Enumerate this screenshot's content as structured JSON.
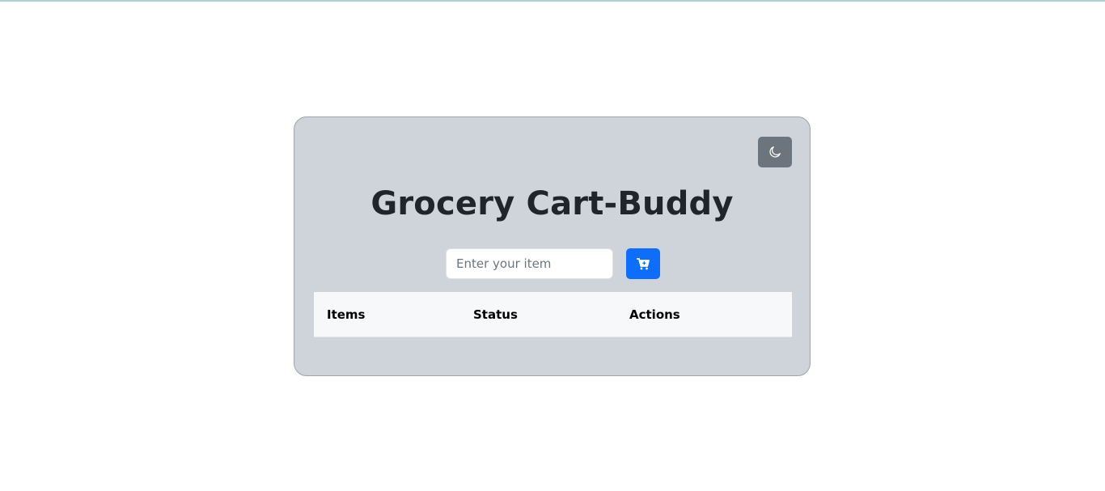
{
  "app": {
    "title": "Grocery Cart-Buddy"
  },
  "theme_toggle": {
    "icon": "moon-icon"
  },
  "add_form": {
    "input_value": "",
    "input_placeholder": "Enter your item",
    "add_icon": "cart-plus-icon"
  },
  "table": {
    "headers": [
      "Items",
      "Status",
      "Actions"
    ],
    "rows": []
  },
  "colors": {
    "card_background": "#cfd4da",
    "primary": "#0d6efd",
    "secondary": "#6c757d",
    "table_header_background": "#f7f8fa"
  }
}
